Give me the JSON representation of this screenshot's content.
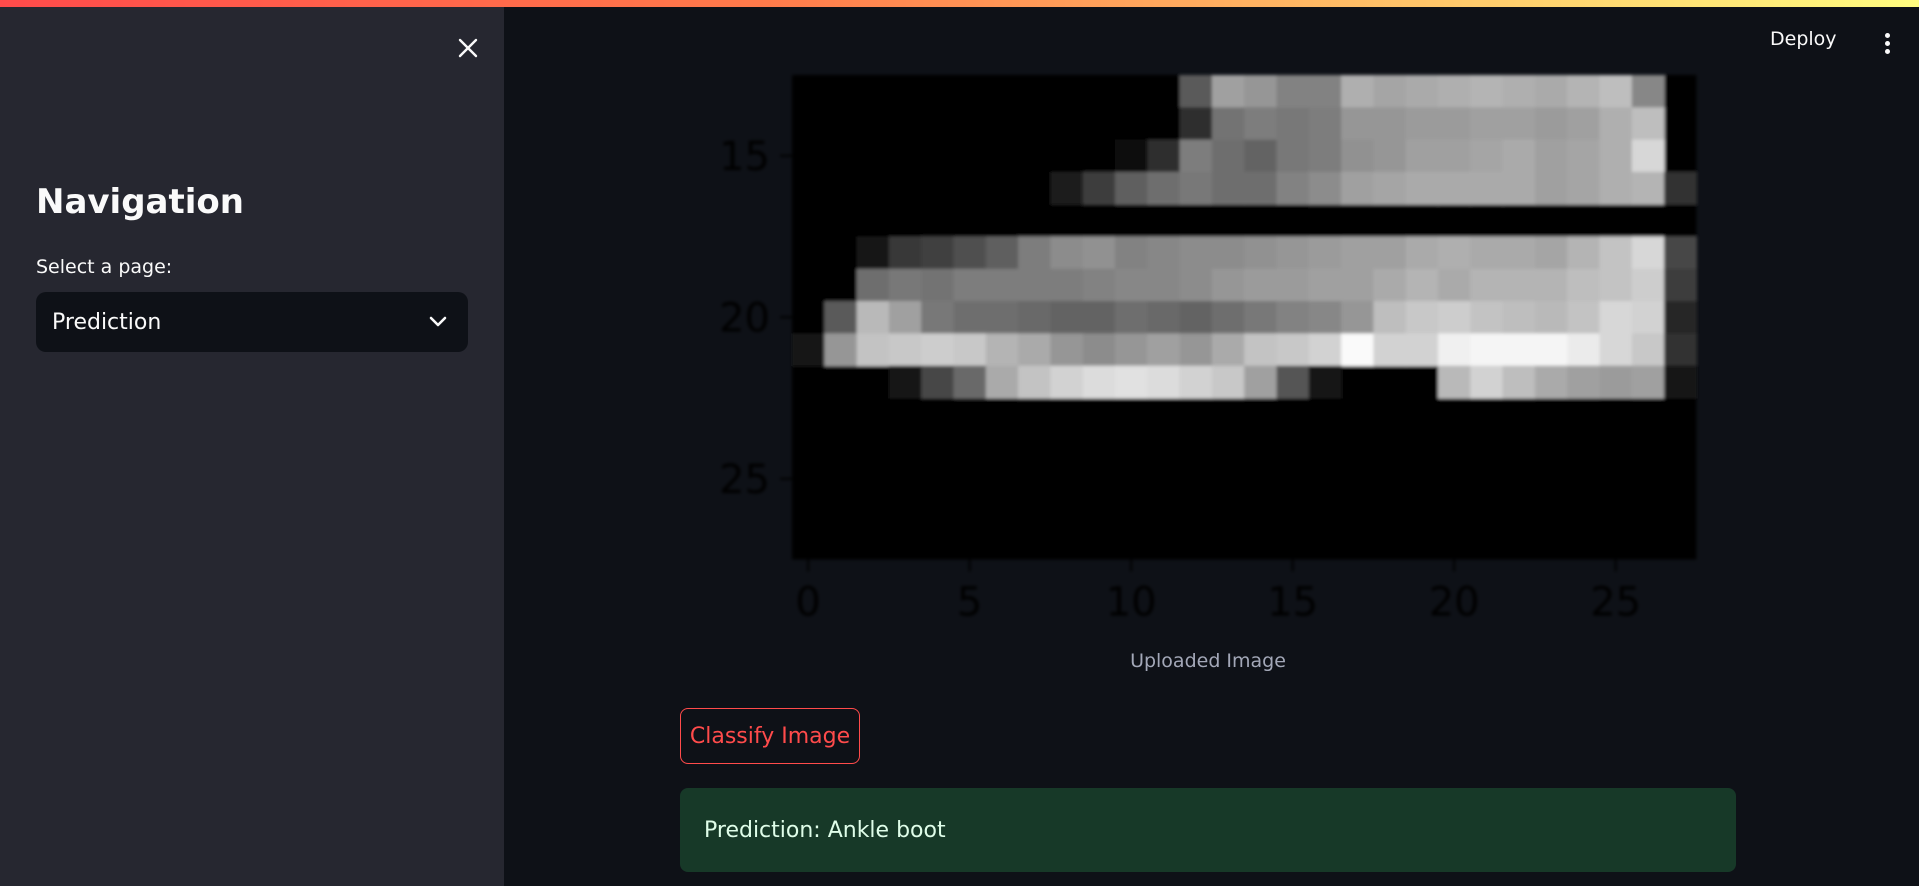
{
  "sidebar": {
    "title": "Navigation",
    "select_label": "Select a page:",
    "select_value": "Prediction"
  },
  "header": {
    "deploy_label": "Deploy"
  },
  "image": {
    "caption": "Uploaded Image",
    "ytick_labels": [
      "15",
      "20",
      "25"
    ],
    "xtick_labels": [
      "0",
      "5",
      "10",
      "15",
      "20",
      "25"
    ],
    "grid_size": 28,
    "visible_rows": [
      13,
      27
    ],
    "pixel_rows": {
      "13": [
        0,
        0,
        0,
        0,
        0,
        0,
        0,
        0,
        0,
        0,
        0,
        0,
        90,
        160,
        150,
        130,
        130,
        175,
        165,
        170,
        175,
        180,
        175,
        170,
        180,
        190,
        135,
        0
      ],
      "14": [
        0,
        0,
        5,
        5,
        5,
        5,
        5,
        5,
        5,
        5,
        5,
        5,
        45,
        115,
        125,
        120,
        125,
        150,
        150,
        155,
        155,
        160,
        160,
        155,
        160,
        175,
        190,
        0
      ],
      "15": [
        0,
        5,
        0,
        0,
        0,
        0,
        0,
        0,
        0,
        0,
        10,
        45,
        125,
        110,
        100,
        120,
        125,
        145,
        150,
        160,
        160,
        165,
        170,
        160,
        165,
        175,
        215,
        0
      ],
      "16": [
        0,
        0,
        0,
        0,
        0,
        0,
        0,
        5,
        30,
        60,
        95,
        110,
        120,
        110,
        110,
        130,
        140,
        160,
        165,
        170,
        170,
        170,
        170,
        160,
        165,
        175,
        180,
        50
      ],
      "17": [
        0,
        0,
        0,
        0,
        0,
        0,
        0,
        0,
        0,
        0,
        0,
        0,
        0,
        0,
        0,
        0,
        0,
        0,
        0,
        0,
        0,
        0,
        0,
        0,
        0,
        0,
        0,
        0
      ],
      "18": [
        0,
        0,
        25,
        55,
        65,
        80,
        95,
        125,
        140,
        145,
        130,
        135,
        140,
        140,
        145,
        150,
        155,
        160,
        160,
        170,
        175,
        170,
        170,
        165,
        180,
        195,
        215,
        70
      ],
      "19": [
        0,
        0,
        110,
        120,
        115,
        125,
        125,
        125,
        125,
        130,
        135,
        135,
        140,
        150,
        155,
        155,
        160,
        160,
        170,
        180,
        170,
        180,
        180,
        180,
        190,
        195,
        205,
        60
      ],
      "20": [
        0,
        90,
        185,
        160,
        120,
        110,
        110,
        105,
        100,
        100,
        110,
        105,
        100,
        110,
        120,
        130,
        135,
        150,
        190,
        200,
        205,
        195,
        190,
        185,
        195,
        215,
        210,
        40
      ],
      "21": [
        20,
        150,
        195,
        200,
        205,
        200,
        180,
        170,
        150,
        140,
        150,
        160,
        150,
        170,
        195,
        200,
        210,
        250,
        210,
        210,
        240,
        245,
        245,
        245,
        235,
        215,
        200,
        50
      ],
      "22": [
        0,
        0,
        0,
        20,
        70,
        105,
        170,
        195,
        210,
        220,
        225,
        220,
        210,
        200,
        160,
        85,
        20,
        0,
        0,
        0,
        185,
        210,
        190,
        170,
        160,
        155,
        160,
        20
      ],
      "23": [
        0,
        0,
        0,
        0,
        0,
        0,
        0,
        0,
        0,
        0,
        0,
        0,
        0,
        0,
        0,
        0,
        0,
        0,
        0,
        0,
        0,
        0,
        0,
        0,
        0,
        0,
        0,
        0
      ],
      "24": [
        0,
        0,
        0,
        0,
        0,
        0,
        0,
        0,
        0,
        0,
        0,
        0,
        0,
        0,
        0,
        0,
        0,
        0,
        0,
        0,
        0,
        0,
        0,
        0,
        0,
        0,
        0,
        0
      ],
      "25": [
        0,
        0,
        0,
        0,
        0,
        0,
        0,
        0,
        0,
        0,
        0,
        0,
        0,
        0,
        0,
        0,
        0,
        0,
        0,
        0,
        0,
        0,
        0,
        0,
        0,
        0,
        0,
        0
      ],
      "26": [
        0,
        0,
        0,
        0,
        0,
        0,
        0,
        0,
        0,
        0,
        0,
        0,
        0,
        0,
        0,
        0,
        0,
        0,
        0,
        0,
        0,
        0,
        0,
        0,
        0,
        0,
        0,
        0
      ],
      "27": [
        0,
        0,
        0,
        0,
        0,
        0,
        0,
        0,
        0,
        0,
        0,
        0,
        0,
        0,
        0,
        0,
        0,
        0,
        0,
        0,
        0,
        0,
        0,
        0,
        0,
        0,
        0,
        0
      ]
    }
  },
  "classify_button": {
    "label": "Classify Image"
  },
  "prediction": {
    "text": "Prediction: Ankle boot"
  },
  "colors": {
    "accent": "#ff4b4b",
    "sidebar_bg": "#262730",
    "main_bg": "#0e1117",
    "success_bg": "#173928"
  }
}
